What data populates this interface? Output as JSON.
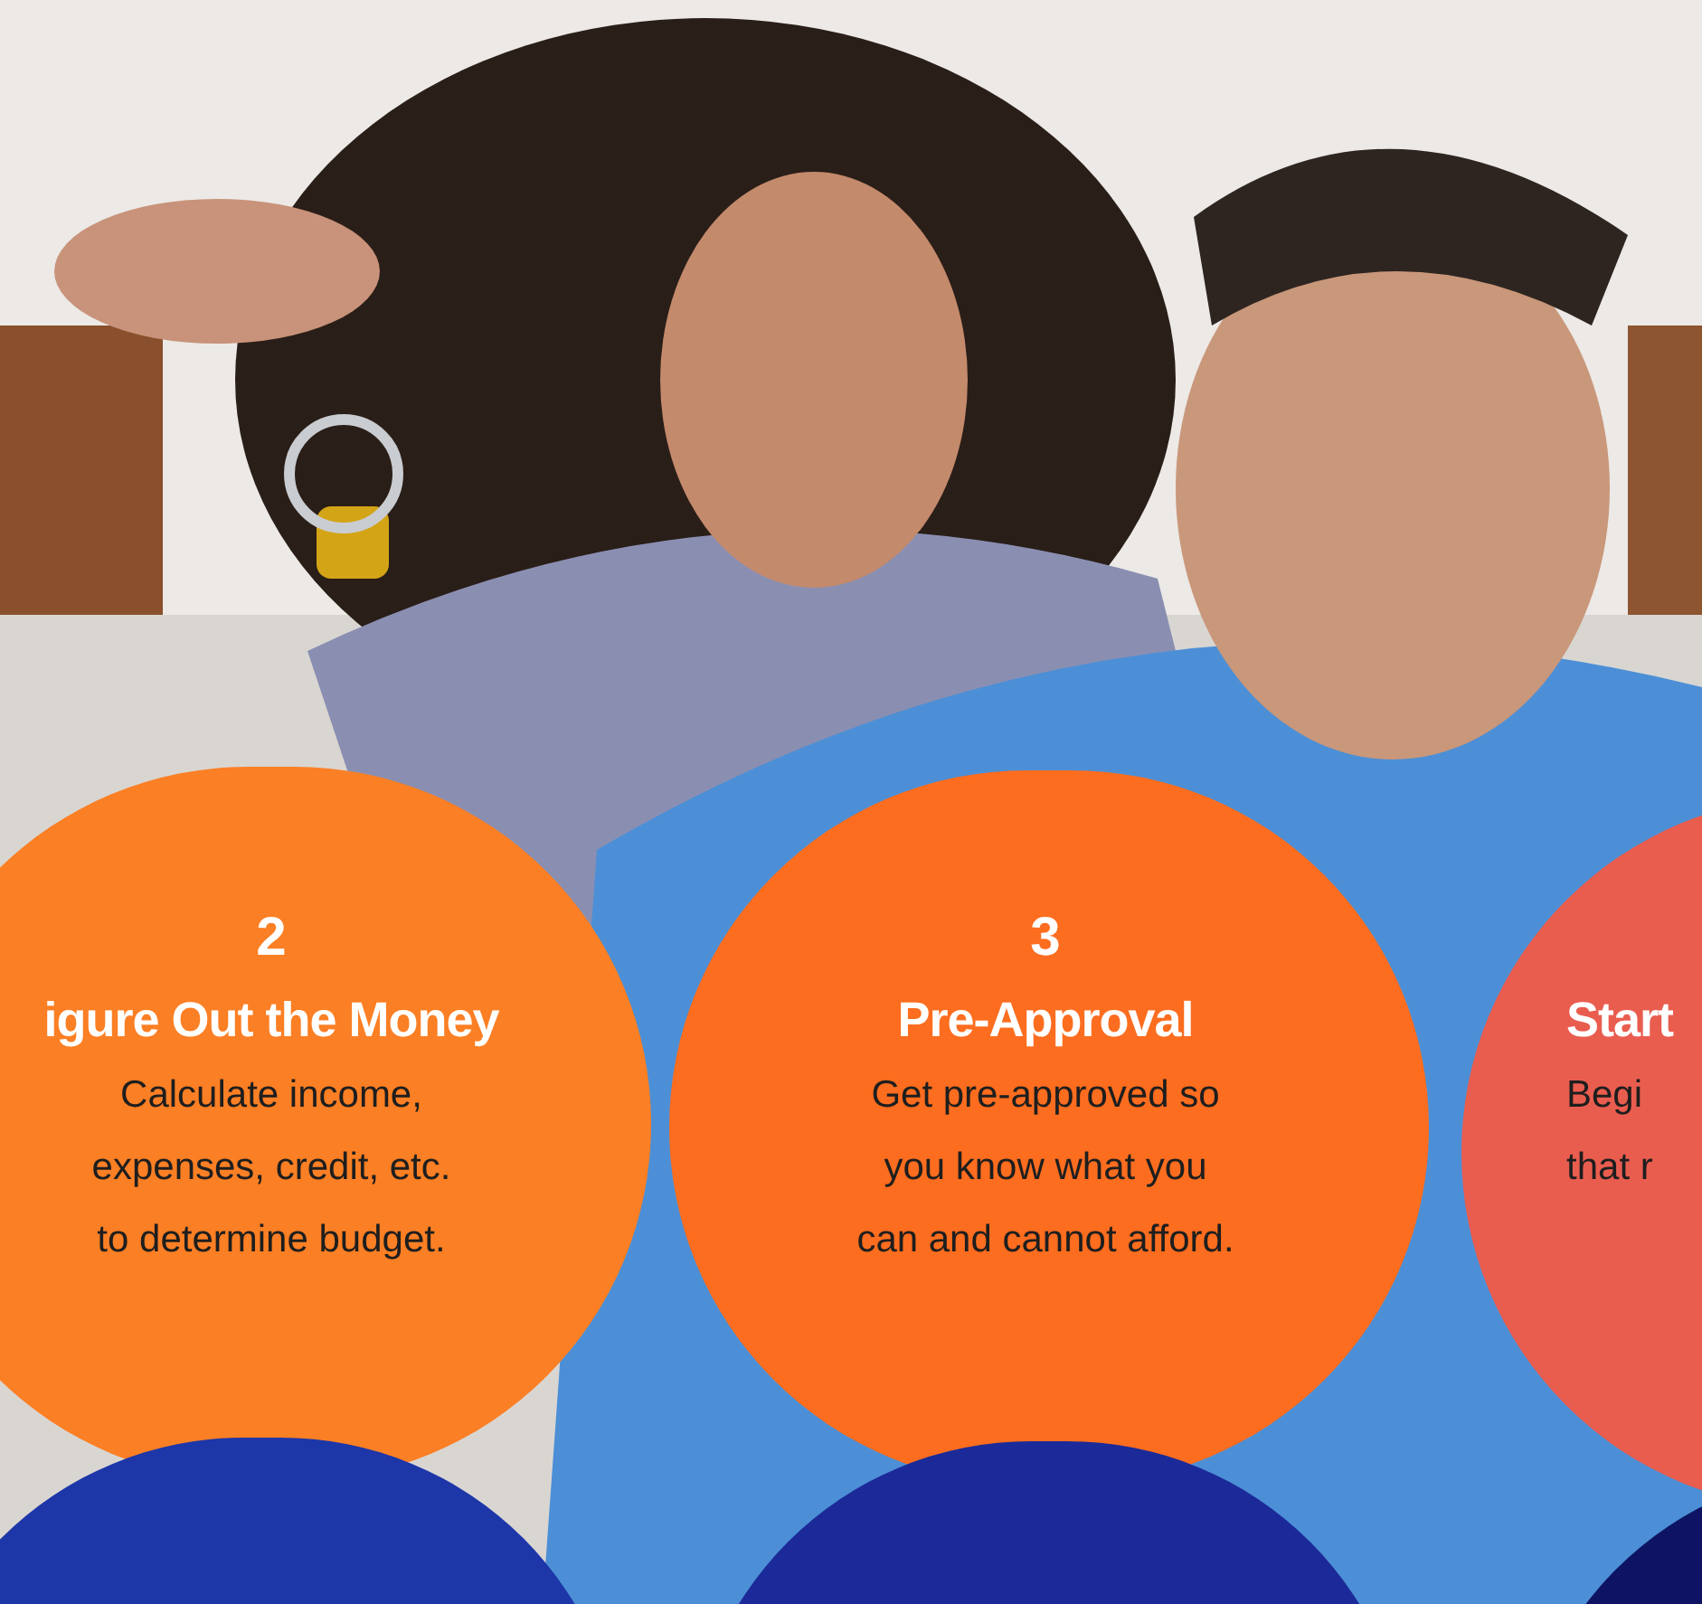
{
  "steps": [
    {
      "number": "2",
      "title": "igure Out the Money",
      "lines": [
        "Calculate income,",
        "expenses, credit, etc.",
        "to determine budget."
      ],
      "color": "#fb7f24"
    },
    {
      "number": "3",
      "title": "Pre-Approval",
      "lines": [
        "Get pre-approved so",
        "you know what you",
        "can and cannot afford."
      ],
      "color": "#fc6d1f"
    },
    {
      "title": "Start",
      "lines": [
        "Begi",
        "that r"
      ],
      "color": "#e95d4f"
    }
  ],
  "next_steps": [
    {
      "color": "#1d36a8"
    },
    {
      "color": "#1b2a98"
    },
    {
      "color": "#0e1463"
    }
  ]
}
